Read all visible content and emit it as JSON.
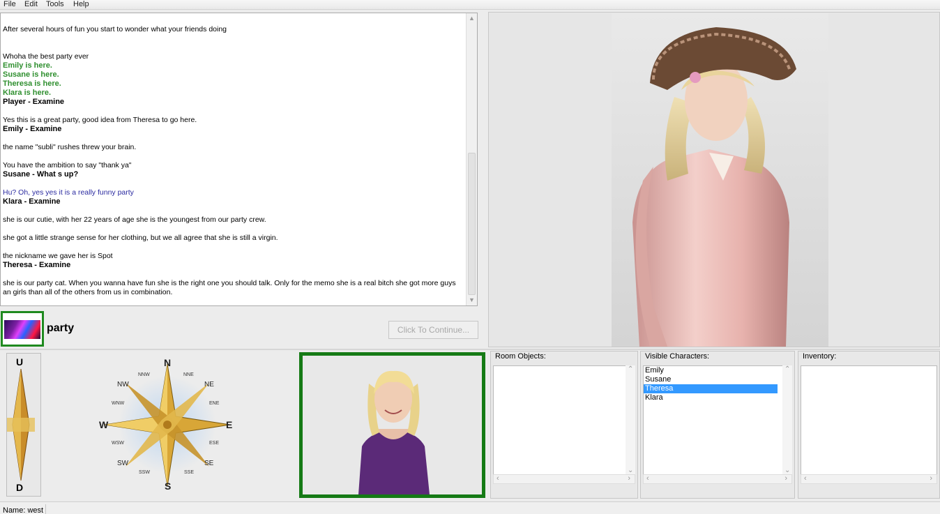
{
  "menu": {
    "items": [
      "File",
      "Edit",
      "Tools",
      "Help"
    ]
  },
  "log": {
    "lines": [
      {
        "text": "After several hours of fun you start to wonder what your friends doing",
        "style": "normal"
      },
      {
        "text": "",
        "style": "normal"
      },
      {
        "text": "",
        "style": "normal"
      },
      {
        "text": "Whoha the best party ever",
        "style": "normal"
      },
      {
        "text": "Emily is here.",
        "style": "green"
      },
      {
        "text": "Susane is here.",
        "style": "green"
      },
      {
        "text": "Theresa is here.",
        "style": "green"
      },
      {
        "text": "Klara is here.",
        "style": "green"
      },
      {
        "text": "Player - Examine",
        "style": "bold"
      },
      {
        "text": "",
        "style": "normal"
      },
      {
        "text": "Yes this is a great party, good idea from Theresa to go here.",
        "style": "normal"
      },
      {
        "text": "Emily - Examine",
        "style": "bold"
      },
      {
        "text": "",
        "style": "normal"
      },
      {
        "text": "the name \"subli\" rushes threw your brain.",
        "style": "normal"
      },
      {
        "text": "",
        "style": "normal"
      },
      {
        "text": "You have the ambition to say \"thank ya\"",
        "style": "normal"
      },
      {
        "text": "Susane - What s up?",
        "style": "bold"
      },
      {
        "text": "",
        "style": "normal"
      },
      {
        "text": "Hu? Oh, yes yes it is a really funny party",
        "style": "blue"
      },
      {
        "text": "Klara - Examine",
        "style": "bold"
      },
      {
        "text": "",
        "style": "normal"
      },
      {
        "text": "she is our cutie, with her 22 years of age she is the youngest from our party crew.",
        "style": "normal"
      },
      {
        "text": "",
        "style": "normal"
      },
      {
        "text": "she got a little strange sense for her clothing, but we all agree that she is still a virgin.",
        "style": "normal"
      },
      {
        "text": "",
        "style": "normal"
      },
      {
        "text": "the nickname we gave her is Spot",
        "style": "normal"
      },
      {
        "text": "Theresa - Examine",
        "style": "bold"
      },
      {
        "text": "",
        "style": "normal"
      },
      {
        "text": "she is our party cat. When you wanna have fun she is the right one you should talk. Only for the memo she is a real bitch she got more guys an girls than all of the others from us in combination.",
        "style": "wrap"
      }
    ]
  },
  "room": {
    "name": "party",
    "continue_label": "Click To Continue..."
  },
  "updown": {
    "up": "U",
    "down": "D"
  },
  "compass": {
    "n": "N",
    "s": "S",
    "e": "E",
    "w": "W",
    "ne": "NE",
    "nw": "NW",
    "se": "SE",
    "sw": "SW",
    "nne": "NNE",
    "nnw": "NNW",
    "ene": "ENE",
    "ese": "ESE",
    "sse": "SSE",
    "ssw": "SSW",
    "wnw": "WNW",
    "wsw": "WSW"
  },
  "panels": {
    "room_objects": {
      "title": "Room Objects:",
      "items": []
    },
    "visible_characters": {
      "title": "Visible Characters:",
      "items": [
        "Emily",
        "Susane",
        "Theresa",
        "Klara"
      ],
      "selected": "Theresa"
    },
    "inventory": {
      "title": "Inventory:",
      "items": []
    }
  },
  "status": {
    "text": "Name: west"
  },
  "colors": {
    "frame_green": "#1f8a1f",
    "selection_blue": "#3399ff",
    "log_green": "#2f8f2f",
    "log_blue": "#2a2aa0"
  }
}
